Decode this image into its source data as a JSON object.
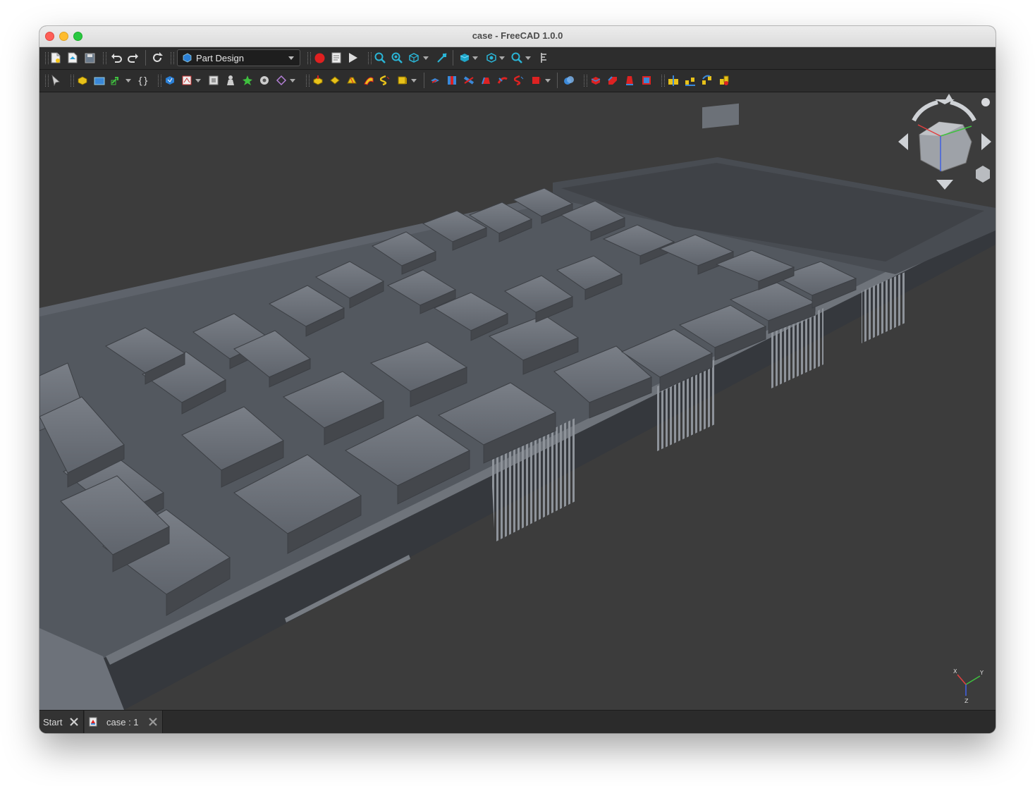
{
  "window": {
    "title": "case - FreeCAD 1.0.0"
  },
  "toolbar": {
    "workbench": {
      "label": "Part Design",
      "icon": "part-design-icon"
    },
    "file_icons": [
      "new-document-icon",
      "open-document-icon",
      "save-icon",
      "undo-icon",
      "redo-icon",
      "refresh-icon"
    ],
    "macro_icons": [
      "macro-record-icon",
      "macro-edit-icon",
      "macro-run-icon"
    ],
    "view_icons": [
      "fit-all-icon",
      "fit-selection-icon",
      "std-view-icon",
      "measure-icon",
      "isometric-icon",
      "draw-style-icon",
      "zoom-icon",
      "ruler-icon"
    ]
  },
  "toolbar2": {
    "icons": [
      "select-icon",
      "create-body-icon",
      "create-part-icon",
      "link-icon",
      "expression-icon",
      "create-sketch-icon",
      "attach-sketch-icon",
      "shape-binder-icon",
      "clone-icon",
      "datum-point-icon",
      "datum-line-icon",
      "datum-plane-icon",
      "pad-icon",
      "revolution-icon",
      "loft-icon",
      "sweep-icon",
      "helix-icon",
      "additive-primitive-icon",
      "pocket-icon",
      "hole-icon",
      "groove-icon",
      "subtractive-loft-icon",
      "subtractive-pipe-icon",
      "subtractive-helix-icon",
      "subtractive-primitive-icon",
      "boolean-icon",
      "fillet-icon",
      "chamfer-icon",
      "draft-icon",
      "thickness-icon",
      "mirrored-icon",
      "linear-pattern-icon",
      "polar-pattern-icon",
      "multi-transform-icon"
    ]
  },
  "viewport": {
    "navcube": "nav-cube",
    "axis_labels": [
      "X",
      "Y",
      "Z"
    ]
  },
  "tabs": [
    {
      "label": "Start",
      "active": false
    },
    {
      "label": "case : 1",
      "active": true
    }
  ],
  "colors": {
    "accent": "#2a9fd6",
    "record": "#e02020",
    "background": "#3c3c3c",
    "model": "#6a6f77"
  }
}
